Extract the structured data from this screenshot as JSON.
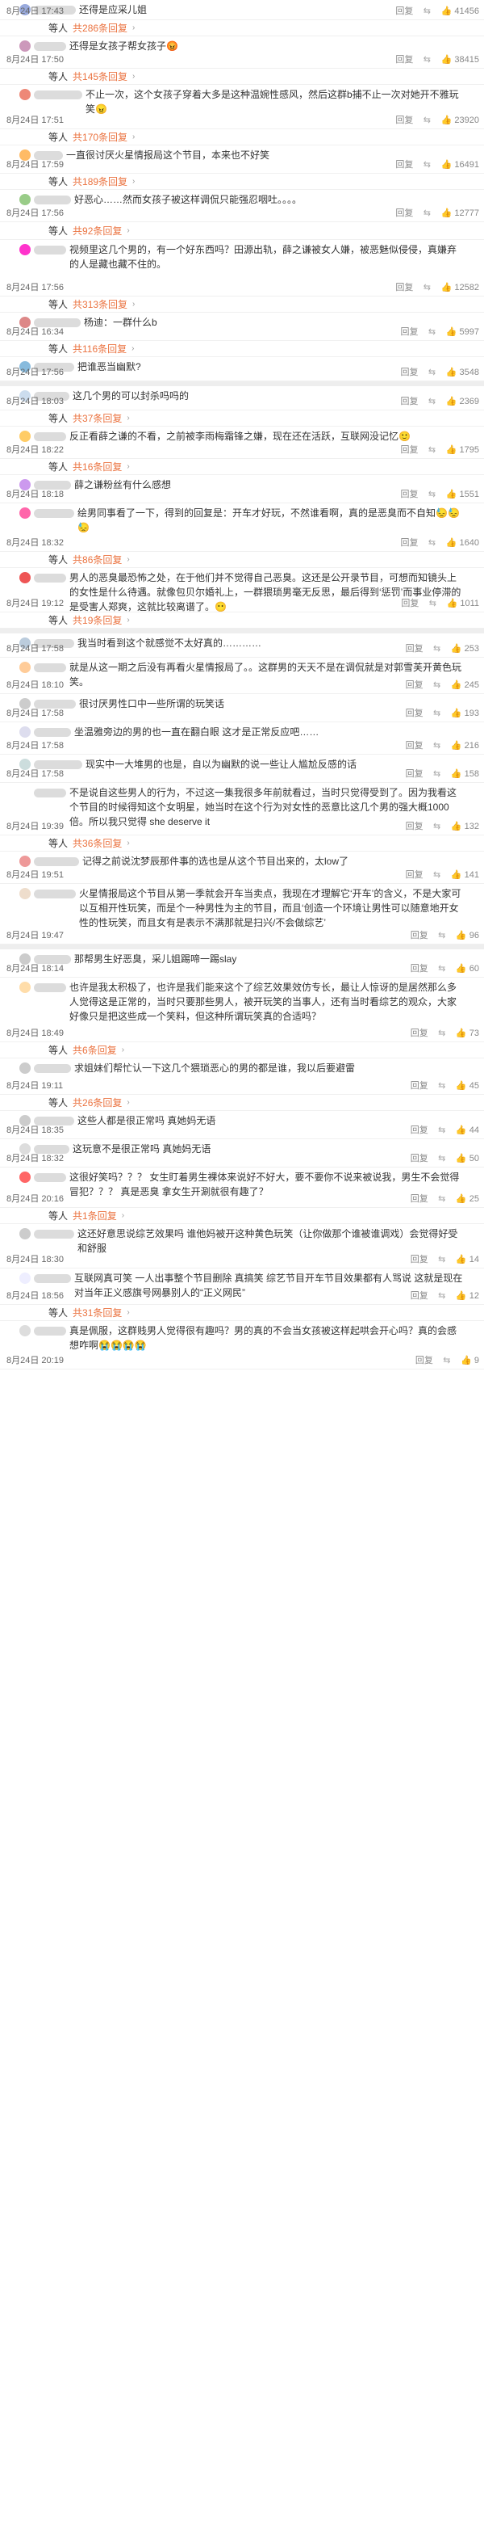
{
  "labels": {
    "wait": "等人",
    "reply": "回复",
    "emoji_label": "🙂"
  },
  "sections": [
    {
      "items": [
        {
          "t": "c",
          "h": 25,
          "text": "还得是应采儿姐",
          "date": "8月24日 17:43",
          "likes": "41456",
          "name_w": 52,
          "av": "#9ad"
        },
        {
          "t": "r",
          "h": 20,
          "replies": "共286条回复"
        },
        {
          "t": "c",
          "h": 40,
          "text": "还得是女孩子帮女孩子😡",
          "date": "8月24日 17:50",
          "likes": "38415",
          "name_w": 40,
          "av": "#c9b"
        },
        {
          "t": "r",
          "h": 20,
          "replies": "共145条回复"
        },
        {
          "t": "c",
          "h": 55,
          "text": "不止一次，这个女孩子穿着大多是这种温婉性感风，然后这群b捕不止一次对她开不雅玩笑😠",
          "date": "8月24日 17:51",
          "likes": "23920",
          "name_w": 60,
          "av": "#e87"
        },
        {
          "t": "r",
          "h": 20,
          "replies": "共170条回复"
        },
        {
          "t": "c",
          "h": 35,
          "text": "一直很讨厌火星情报局这个节目，本来也不好笑",
          "date": "8月24日 17:59",
          "likes": "16491",
          "name_w": 36,
          "av": "#fb6"
        },
        {
          "t": "r",
          "h": 20,
          "replies": "共189条回复"
        },
        {
          "t": "c",
          "h": 40,
          "text": "好恶心……然而女孩子被这样调侃只能强忍咽吐。。。。",
          "date": "8月24日 17:56",
          "likes": "12777",
          "name_w": 46,
          "av": "#9c8"
        },
        {
          "t": "r",
          "h": 22,
          "replies": "共92条回复"
        },
        {
          "t": "c",
          "h": 70,
          "text": "视频里这几个男的，有一个好东西吗？田源出轨，薛之谦被女人嫌，被恶魅似侵侵，真嫌弃的人是藏也藏不住的。",
          "date": "8月24日 17:56",
          "likes": "12582",
          "name_w": 40,
          "av": "#f3c"
        },
        {
          "t": "r",
          "h": 20,
          "replies": "共313条回复"
        },
        {
          "t": "c",
          "h": 35,
          "text": "杨迪：一群什么b",
          "date": "8月24日 16:34",
          "likes": "5997",
          "name_w": 58,
          "av": "#d88"
        },
        {
          "t": "r",
          "h": 20,
          "replies": "共116条回复"
        },
        {
          "t": "c",
          "h": 30,
          "text": "把谁恶当幽默?",
          "date": "8月24日 17:56",
          "likes": "3548",
          "name_w": 50,
          "av": "#8bd"
        }
      ]
    },
    {
      "items": [
        {
          "t": "c",
          "h": 30,
          "text": "这几个男的可以封杀吗吗的",
          "date": "8月24日 18:03",
          "likes": "2369",
          "name_w": 44,
          "av": "#cde"
        },
        {
          "t": "r",
          "h": 20,
          "replies": "共37条回复"
        },
        {
          "t": "c",
          "h": 40,
          "text": "反正看薛之谦的不看，之前被李雨梅霜锋之嫌，现在还在活跃，互联网没记忆🙂",
          "date": "8月24日 18:22",
          "likes": "1795",
          "name_w": 40,
          "av": "#fc6"
        },
        {
          "t": "r",
          "h": 20,
          "replies": "共16条回复"
        },
        {
          "t": "c",
          "h": 35,
          "text": "薛之谦粉丝有什么感想",
          "date": "8月24日 18:18",
          "likes": "1551",
          "name_w": 46,
          "av": "#c9e"
        },
        {
          "t": "c",
          "h": 60,
          "text": "绘男同事看了一下，得到的回复是：开车才好玩，不然谁看啊，真的是恶臭而不自知😓😓😓",
          "date": "8月24日 18:32",
          "likes": "1640",
          "name_w": 50,
          "av": "#f6a"
        },
        {
          "t": "r",
          "h": 20,
          "replies": "共86条回复"
        },
        {
          "t": "c",
          "h": 55,
          "text": "男人的恶臭最恐怖之处，在于他们并不觉得自己恶臭。这还是公开录节目，可想而知镜头上的女性是什么待遇。就像包贝尔婚礼上，一群猥琐男毫无反思，最后得到‘惩罚’而事业停滞的是受害人郑爽，这就比较离谱了。😶",
          "date": "8月24日 19:12",
          "likes": "1011",
          "name_w": 40,
          "av": "#e55"
        },
        {
          "t": "r",
          "h": 20,
          "replies": "共19条回复"
        }
      ]
    },
    {
      "items": [
        {
          "t": "c",
          "h": 30,
          "text": "我当时看到这个就感觉不太好真的…………",
          "date": "8月24日 17:58",
          "likes": "253",
          "name_w": 50,
          "av": "#bcd"
        },
        {
          "t": "c",
          "h": 45,
          "text": "就是从这一期之后没有再看火星情报局了。。这群男的天天不是在调侃就是对郭雪芙开黄色玩笑。",
          "date": "8月24日 18:10",
          "likes": "245",
          "name_w": 40,
          "av": "#fc9"
        },
        {
          "t": "c",
          "h": 35,
          "text": "很讨厌男性口中一些所谓的玩笑话",
          "date": "8月24日 17:58",
          "likes": "193",
          "name_w": 52,
          "av": "#ccc"
        },
        {
          "t": "c",
          "h": 40,
          "text": "坐温雅旁边的男的也一直在翻白眼 这才是正常反应吧……",
          "date": "8月24日 17:58",
          "likes": "216",
          "name_w": 46,
          "av": "#dde"
        },
        {
          "t": "c",
          "h": 35,
          "text": "现实中一大堆男的也是，自以为幽默的说一些让人尴尬反感的话",
          "date": "8月24日 17:58",
          "likes": "158",
          "name_w": 60,
          "av": "#cdd"
        },
        {
          "t": "c",
          "h": 65,
          "text": "不是说自这些男人的行为，不过这一集我很多年前就看过，当时只觉得受到了。因为我看这个节目的时候得知这个女明星，她当时在这个行为对女性的恶意比这几个男的强大概1000倍。所以我只觉得 she deserve it",
          "date": "8月24日 19:39",
          "likes": "132",
          "name_w": 40,
          "av": "#fff"
        },
        {
          "t": "r",
          "h": 20,
          "replies": "共36条回复"
        },
        {
          "t": "c",
          "h": 40,
          "text": "记得之前说沈梦辰那件事的选也是从这个节目出来的，太low了",
          "date": "8月24日 19:51",
          "likes": "141",
          "name_w": 56,
          "av": "#e99"
        },
        {
          "t": "c",
          "h": 75,
          "text": "火星情报局这个节目从第一季就会开车当卖点，我现在才理解它‘开车’的含义，不是大家可以互相开性玩笑，而是个一种男性为主的节目，而且‘创造一个环境让男性可以随意地开女性的性玩笑，而且女有是表示不满那就是扫兴/不会做综艺’",
          "date": "8月24日 19:47",
          "likes": "96",
          "name_w": 52,
          "av": "#edc"
        }
      ]
    },
    {
      "items": [
        {
          "t": "c",
          "h": 35,
          "text": "那帮男生好恶臭，采儿姐踢啼一踢slay",
          "date": "8月24日 18:14",
          "likes": "60",
          "name_w": 46,
          "av": "#ccc"
        },
        {
          "t": "c",
          "h": 80,
          "text": "也许是我太积极了，也许是我们能来这个了综艺效果效仿专长，最让人惊讶的是居然那么多人觉得这是正常的，当时只要那些男人，被开玩笑的当事人，还有当时看综艺的观众，大家好像只是把这些成一个笑料，但这种所谓玩笑真的合适吗？",
          "date": "8月24日 18:49",
          "likes": "73",
          "name_w": 40,
          "av": "#fda"
        },
        {
          "t": "r",
          "h": 20,
          "replies": "共6条回复"
        },
        {
          "t": "c",
          "h": 45,
          "text": "求姐妹们帮忙认一下这几个猥琐恶心的男的都是谁，我以后要避雷",
          "date": "8月24日 19:11",
          "likes": "45",
          "name_w": 46,
          "av": "#ccc"
        },
        {
          "t": "r",
          "h": 20,
          "replies": "共26条回复"
        },
        {
          "t": "c",
          "h": 35,
          "text": "这些人都是很正常吗 真她妈无语",
          "date": "8月24日 18:35",
          "likes": "44",
          "name_w": 50,
          "av": "#ccc"
        },
        {
          "t": "c",
          "h": 35,
          "text": "这玩意不是很正常吗 真她妈无语",
          "date": "8月24日 18:32",
          "likes": "50",
          "name_w": 44,
          "av": "#ddd"
        },
        {
          "t": "c",
          "h": 50,
          "text": "这很好笑吗？？？ 女生盯着男生裸体来说好不好大，要不要你不说来被说我，男生不会觉得冒犯？？？ 真是恶臭 拿女生开涮就很有趣了？",
          "date": "8月24日 20:16",
          "likes": "25",
          "name_w": 40,
          "av": "#f66"
        },
        {
          "t": "r",
          "h": 20,
          "replies": "共1条回复"
        },
        {
          "t": "c",
          "h": 55,
          "text": "这还好意思说综艺效果吗 谁他妈被开这种黄色玩笑（让你做那个谁被谁调戏）会觉得好受和舒服",
          "date": "8月24日 18:30",
          "likes": "14",
          "name_w": 50,
          "av": "#ccc"
        },
        {
          "t": "c",
          "h": 45,
          "text": "互联网真可笑 一人出事整个节目删除 真搞笑 综艺节目开车节目效果都有人骂说 这就是现在对当年正义感旗号网暴别人的“正义网民”",
          "date": "8月24日 18:56",
          "likes": "12",
          "name_w": 46,
          "av": "#eef"
        },
        {
          "t": "r",
          "h": 20,
          "replies": "共31条回复"
        },
        {
          "t": "c",
          "h": 60,
          "text": "真是佩服，这群贱男人觉得很有趣吗？男的真的不会当女孩被这样起哄会开心吗？真的会感想咋啊😭😭😭😭",
          "date": "8月24日 20:19",
          "likes": "9",
          "name_w": 40,
          "av": "#ddd"
        }
      ]
    }
  ]
}
